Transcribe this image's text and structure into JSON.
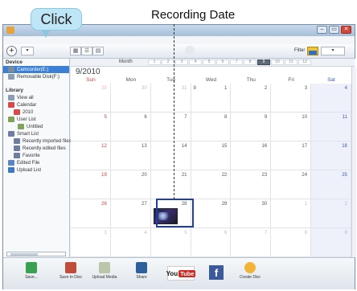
{
  "annotations": {
    "click_label": "Click",
    "recording_date_label": "Recording Date"
  },
  "toolbar": {
    "add_symbol": "+",
    "filter_label": "Filter"
  },
  "sidebar": {
    "device_header": "Device",
    "devices": [
      "Camcorder(E:)",
      "Removable Disk(F:)"
    ],
    "library_header": "Library",
    "library_items": [
      {
        "label": "View all",
        "level": 1
      },
      {
        "label": "Calendar",
        "level": 1
      },
      {
        "label": "2010",
        "level": 2
      },
      {
        "label": "User List",
        "level": 1
      },
      {
        "label": "Untitled",
        "level": 3
      },
      {
        "label": "Smart List",
        "level": 1
      },
      {
        "label": "Recently imported files",
        "level": 2
      },
      {
        "label": "Recently edited files",
        "level": 2
      },
      {
        "label": "Favorite",
        "level": 2
      },
      {
        "label": "Edited File",
        "level": 1
      },
      {
        "label": "Upload List",
        "level": 1
      }
    ]
  },
  "calendar": {
    "month_label": "Month",
    "month_cells": [
      "1",
      "2",
      "3",
      "4",
      "5",
      "6",
      "7",
      "8",
      "9",
      "10",
      "11",
      "12"
    ],
    "selected_month_index": 8,
    "title": "9/2010",
    "day_names": [
      "Sun",
      "Mon",
      "Tue",
      "Wed",
      "Thu",
      "Fri",
      "Sat"
    ],
    "weeks": [
      [
        "29",
        "30",
        "31",
        "1",
        "2",
        "3",
        "4"
      ],
      [
        "5",
        "6",
        "7",
        "8",
        "9",
        "10",
        "11"
      ],
      [
        "12",
        "13",
        "14",
        "15",
        "16",
        "17",
        "18"
      ],
      [
        "19",
        "20",
        "21",
        "22",
        "23",
        "24",
        "25"
      ],
      [
        "26",
        "27",
        "28",
        "29",
        "30",
        "1",
        "2"
      ],
      [
        "3",
        "4",
        "5",
        "6",
        "7",
        "8",
        "9"
      ]
    ],
    "wed_left_label": "9",
    "thumbnail_date": "28"
  },
  "bottom": {
    "items": [
      {
        "label": "Save..."
      },
      {
        "label": "Save to Disc"
      },
      {
        "label": "Upload Media"
      },
      {
        "label": "Share"
      },
      {
        "label": "Create Disc"
      }
    ],
    "youtube_you": "You",
    "youtube_tube": "Tube",
    "facebook_letter": "f"
  },
  "colors": {
    "sunday": "#d33b3b",
    "saturday": "#3a57b3",
    "selection": "#3b7fd6",
    "highlight_frame": "#1f3ea8"
  }
}
